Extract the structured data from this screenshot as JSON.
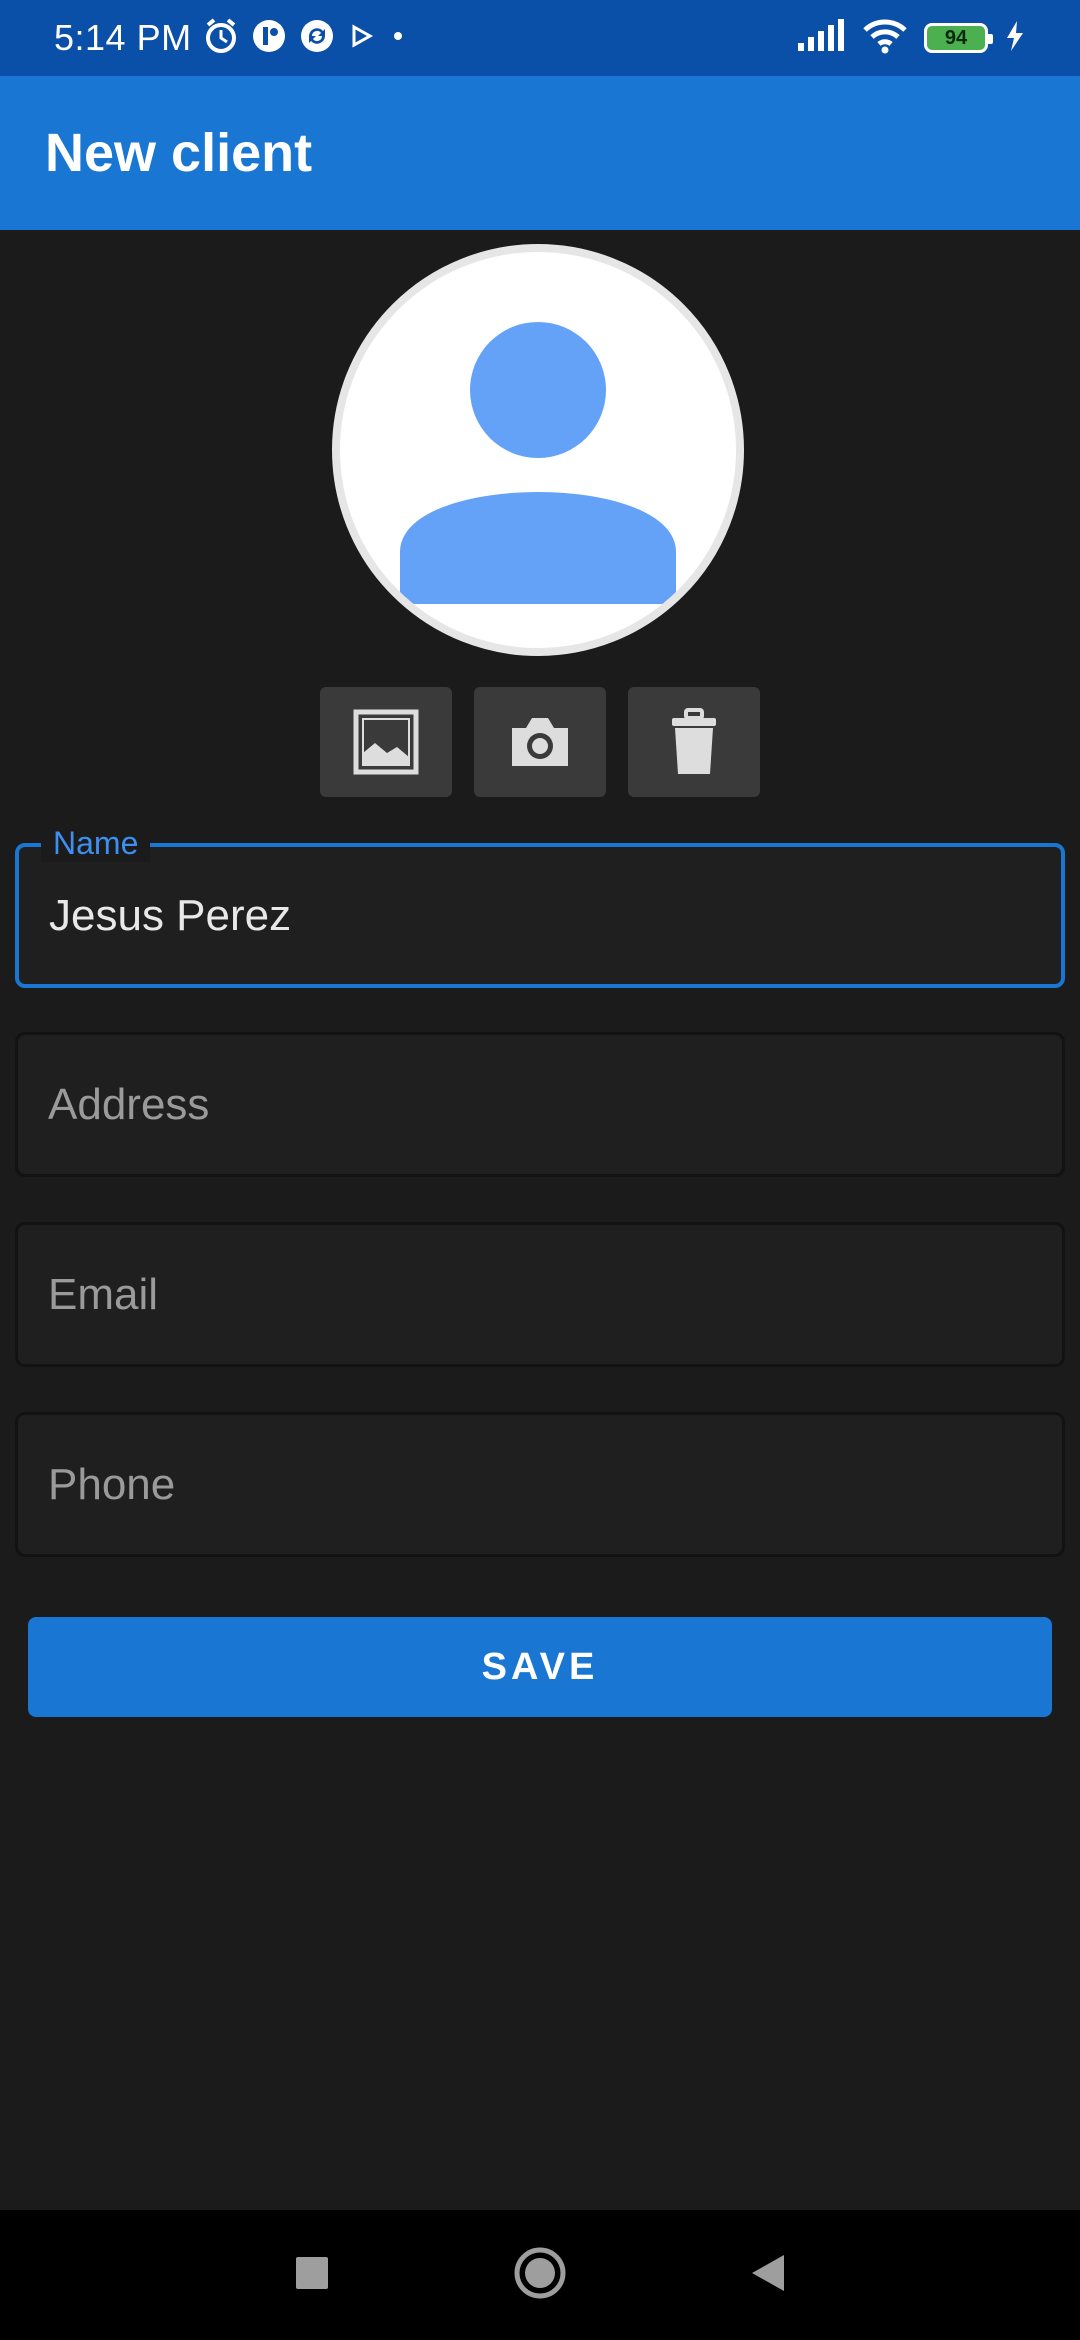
{
  "status_bar": {
    "time": "5:14 PM",
    "battery_level": "94",
    "icons": [
      "alarm-icon",
      "app-notification-icon",
      "sync-icon",
      "play-icon",
      "dot-icon",
      "signal-icon",
      "wifi-icon",
      "battery-icon",
      "charging-icon"
    ]
  },
  "app_bar": {
    "title": "New client"
  },
  "avatar": {
    "icon": "person-icon",
    "color": "#64a2f8"
  },
  "photo_actions": [
    {
      "icon": "gallery-icon"
    },
    {
      "icon": "camera-icon"
    },
    {
      "icon": "trash-icon"
    }
  ],
  "form": {
    "name": {
      "label": "Name",
      "value": "Jesus Perez"
    },
    "address": {
      "placeholder": "Address"
    },
    "email": {
      "placeholder": "Email"
    },
    "phone": {
      "placeholder": "Phone"
    }
  },
  "save_button": {
    "label": "SAVE"
  },
  "colors": {
    "primary": "#1976d2",
    "status_bar": "#0a4fa8",
    "background": "#1b1b1b",
    "label_accent": "#3d8ff0"
  },
  "nav_bar": {
    "icons": [
      "recents-icon",
      "home-icon",
      "back-icon"
    ]
  }
}
